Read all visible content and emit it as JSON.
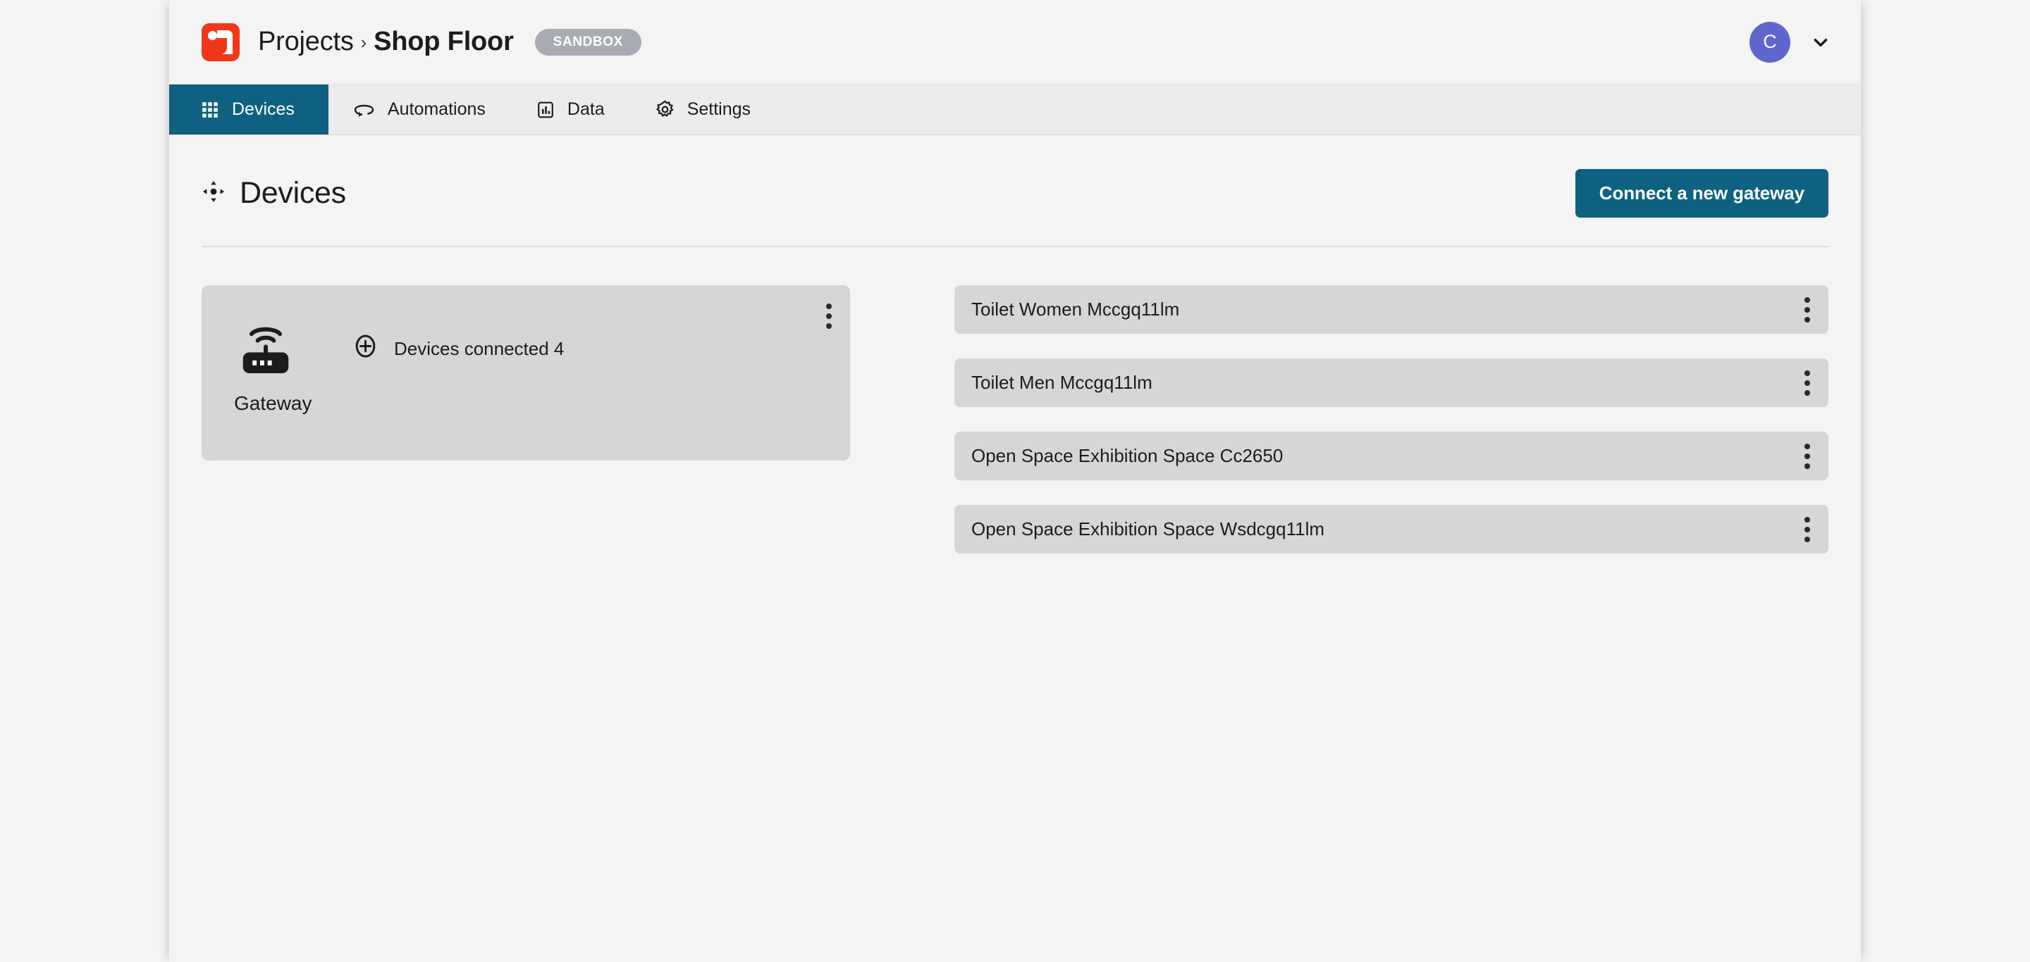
{
  "topbar": {
    "logo_icon": "tractive-logo-icon",
    "breadcrumb": {
      "root": "Projects",
      "separator": "›",
      "current": "Shop Floor"
    },
    "environment_badge": "SANDBOX",
    "avatar_initial": "C",
    "account_chevron_icon": "chevron-down-icon"
  },
  "nav": {
    "tabs": [
      {
        "label": "Devices",
        "icon": "grid-icon",
        "active": true
      },
      {
        "label": "Automations",
        "icon": "loop-arrow-icon",
        "active": false
      },
      {
        "label": "Data",
        "icon": "bar-chart-icon",
        "active": false
      },
      {
        "label": "Settings",
        "icon": "gear-icon",
        "active": false
      }
    ]
  },
  "page": {
    "title": "Devices",
    "title_icon": "move-arrows-icon",
    "primary_action": "Connect a new gateway"
  },
  "gateways": [
    {
      "name": "Gateway",
      "icon": "router-wifi-icon",
      "connected_label": "Devices connected 4",
      "connected_count": "4",
      "add_icon": "plus-circle-icon",
      "menu_icon": "kebab-menu-icon"
    }
  ],
  "devices": [
    {
      "name": "Toilet Women Mccgq11lm",
      "menu_icon": "kebab-menu-icon"
    },
    {
      "name": "Toilet Men Mccgq11lm",
      "menu_icon": "kebab-menu-icon"
    },
    {
      "name": "Open Space Exhibition Space Cc2650",
      "menu_icon": "kebab-menu-icon"
    },
    {
      "name": "Open Space Exhibition Space Wsdcgq11lm",
      "menu_icon": "kebab-menu-icon"
    }
  ],
  "colors": {
    "accent_teal": "#0e6180",
    "logo_red": "#f1371a",
    "badge_gray": "#a9abb3",
    "avatar_purple": "#5f67cc",
    "card_gray": "#d6d6d6",
    "page_bg": "#f4f4f4",
    "nav_bg": "#ececec"
  }
}
